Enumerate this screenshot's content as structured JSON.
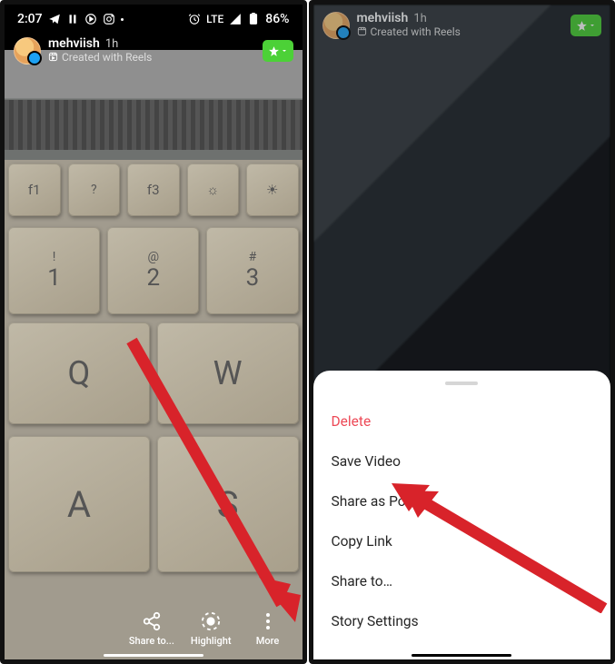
{
  "status": {
    "time": "2:07",
    "network": "LTE",
    "battery": "86%"
  },
  "story": {
    "username": "mehviish",
    "timestamp": "1h",
    "created_with": "Created with Reels"
  },
  "actions": {
    "share_to": "Share to...",
    "highlight": "Highlight",
    "more": "More"
  },
  "sheet": {
    "delete": "Delete",
    "save_video": "Save Video",
    "share_as_post": "Share as Post…",
    "copy_link": "Copy Link",
    "share_to": "Share to…",
    "story_settings": "Story Settings"
  }
}
